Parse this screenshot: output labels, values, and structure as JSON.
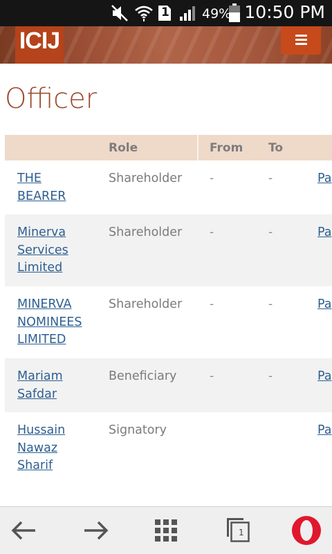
{
  "status_bar": {
    "battery_percent": "49%",
    "time": "10:50 PM",
    "sim_slot": "1",
    "icons": [
      "mute-icon",
      "wifi-icon",
      "sim-icon",
      "signal-icon",
      "battery-icon"
    ]
  },
  "header": {
    "logo_text": "ICIJ",
    "menu_icon": "hamburger-menu-icon"
  },
  "page": {
    "title": "Officer"
  },
  "table": {
    "columns": [
      "",
      "Role",
      "From",
      "To"
    ],
    "rows": [
      {
        "name_lines": [
          "THE",
          "BEARER"
        ],
        "role": "Shareholder",
        "from": "-",
        "to": "-",
        "link": "Pa"
      },
      {
        "name_lines": [
          "Minerva",
          "Services",
          "Limited"
        ],
        "role": "Shareholder",
        "from": "-",
        "to": "-",
        "link": "Pa"
      },
      {
        "name_lines": [
          "MINERVA",
          "NOMINEES",
          "LIMITED"
        ],
        "role": "Shareholder",
        "from": "-",
        "to": "-",
        "link": "Pa"
      },
      {
        "name_lines": [
          "Mariam",
          "Safdar"
        ],
        "role": "Beneficiary",
        "from": "-",
        "to": "-",
        "link": "Pa"
      },
      {
        "name_lines": [
          "Hussain",
          "Nawaz",
          "Sharif"
        ],
        "role": "Signatory",
        "from": "",
        "to": "",
        "link": "Pa"
      }
    ]
  },
  "bottom_nav": {
    "tab_count": "1",
    "items": [
      "back-arrow-icon",
      "forward-arrow-icon",
      "speed-dial-grid-icon",
      "tabs-icon",
      "opera-menu-icon"
    ],
    "colors": {
      "opera_red": "#e0182d",
      "icon_gray": "#555555"
    }
  }
}
